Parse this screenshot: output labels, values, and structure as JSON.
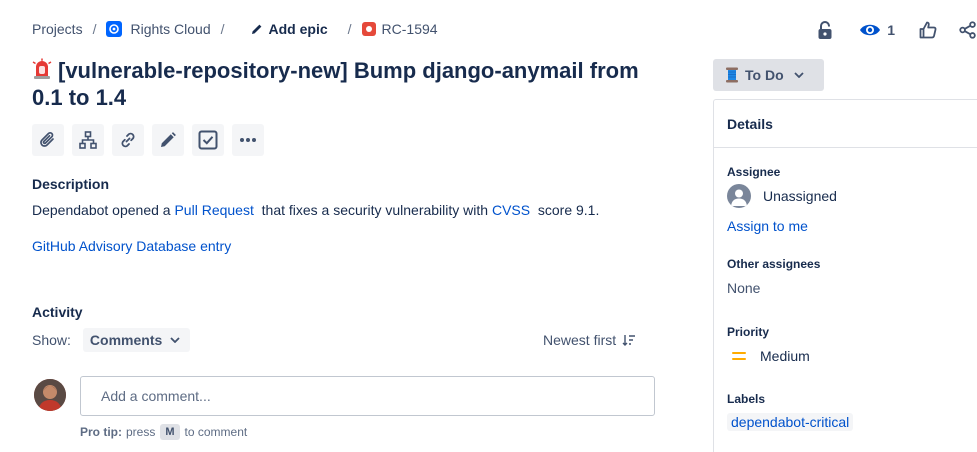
{
  "breadcrumb": {
    "projects": "Projects",
    "project_name": "Rights Cloud",
    "add_epic": "Add epic",
    "issue_key": "RC-1594",
    "separator": "/"
  },
  "top_actions": {
    "watch_count": "1",
    "icons": [
      "unlock-icon",
      "eye-icon",
      "thumbs-up-icon",
      "share-icon"
    ]
  },
  "issue": {
    "title": "[vulnerable-repository-new] Bump django-anymail from 0.1 to 1.4",
    "type_icon": "siren-icon"
  },
  "toolbar": {
    "icons": [
      "attach-icon",
      "child-issue-icon",
      "link-icon",
      "edit-icon",
      "checkbox-icon",
      "more-icon"
    ]
  },
  "description": {
    "label": "Description",
    "text_before": "Dependabot opened a ",
    "pull_request_link": "Pull Request",
    "text_middle": "  that fixes a security vulnerability with ",
    "cvss_link": "CVSS",
    "text_after": "  score 9.1.",
    "advisory_link": "GitHub Advisory Database entry"
  },
  "activity": {
    "label": "Activity",
    "show_label": "Show:",
    "filter_value": "Comments",
    "sort_label": "Newest first",
    "comment_placeholder": "Add a comment...",
    "protip_bold": "Pro tip:",
    "protip_text_1": "press",
    "protip_key": "M",
    "protip_text_2": "to comment"
  },
  "status": {
    "label": "To Do"
  },
  "details": {
    "header": "Details",
    "assignee_label": "Assignee",
    "assignee_value": "Unassigned",
    "assign_to_me": "Assign to me",
    "other_assignees_label": "Other assignees",
    "other_assignees_value": "None",
    "priority_label": "Priority",
    "priority_value": "Medium",
    "labels_label": "Labels",
    "label_value": "dependabot-critical"
  },
  "colors": {
    "link": "#0052cc",
    "text": "#172b4d",
    "priority_medium": "#ffab00",
    "issue_type_red": "#e5493a",
    "project_blue": "#0065ff"
  }
}
